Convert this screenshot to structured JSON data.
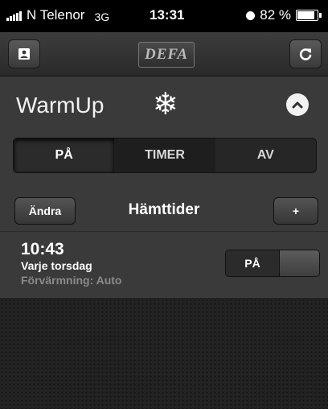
{
  "status": {
    "carrier": "N Telenor",
    "network": "3G",
    "time": "13:31",
    "battery": "82 %"
  },
  "navbar": {
    "logo_text": "DEFA",
    "left_icon": "contact-card-icon",
    "right_icon": "refresh-icon"
  },
  "warmup": {
    "title": "WarmUp",
    "icon": "snowflake-icon",
    "collapse_icon": "chevron-up-icon"
  },
  "mode": {
    "options": [
      "PÅ",
      "TIMER",
      "AV"
    ],
    "selected": "PÅ"
  },
  "schedule": {
    "edit_label": "Ändra",
    "title": "Hämttider",
    "add_label": "+"
  },
  "entry": {
    "time": "10:43",
    "repeat": "Varje torsdag",
    "preheat": "Förvärmning: Auto",
    "toggle_label": "PÅ"
  }
}
